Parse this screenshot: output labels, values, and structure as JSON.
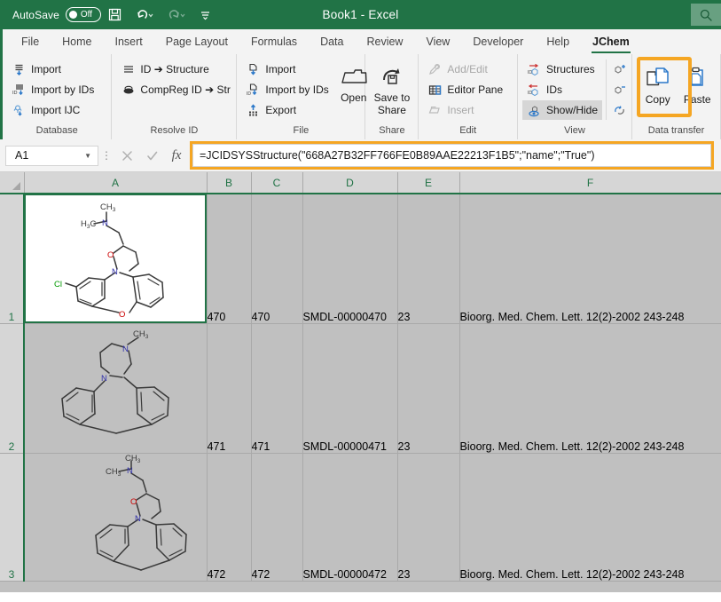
{
  "titlebar": {
    "autosave_label": "AutoSave",
    "autosave_state": "Off",
    "save_icon": "save-icon",
    "undo_icon": "undo-icon",
    "redo_icon": "redo-icon",
    "customize_icon": "customize-quick-access-toolbar-icon",
    "document_title": "Book1  -  Excel",
    "search_icon": "search-icon"
  },
  "tabs": [
    {
      "label": "File",
      "active": false
    },
    {
      "label": "Home",
      "active": false
    },
    {
      "label": "Insert",
      "active": false
    },
    {
      "label": "Page Layout",
      "active": false
    },
    {
      "label": "Formulas",
      "active": false
    },
    {
      "label": "Data",
      "active": false
    },
    {
      "label": "Review",
      "active": false
    },
    {
      "label": "View",
      "active": false
    },
    {
      "label": "Developer",
      "active": false
    },
    {
      "label": "Help",
      "active": false
    },
    {
      "label": "JChem",
      "active": true
    }
  ],
  "ribbon": {
    "groups": [
      {
        "title": "Database",
        "items": [
          {
            "label": "Import",
            "icon": "import-icon",
            "disabled": false
          },
          {
            "label": "Import by IDs",
            "icon": "import-by-ids-icon",
            "disabled": false
          },
          {
            "label": "Import IJC",
            "icon": "import-ijc-icon",
            "disabled": false
          }
        ]
      },
      {
        "title": "Resolve ID",
        "items": [
          {
            "label": "ID ➔ Structure",
            "icon": "id-to-structure-icon",
            "disabled": false
          },
          {
            "label": "CompReg ID ➔ Str",
            "icon": "compreg-id-to-structure-icon",
            "disabled": false
          }
        ]
      },
      {
        "title": "File",
        "items": [
          {
            "label": "Import",
            "icon": "file-import-icon",
            "disabled": false
          },
          {
            "label": "Import by IDs",
            "icon": "file-import-by-ids-icon",
            "disabled": false
          },
          {
            "label": "Export",
            "icon": "file-export-icon",
            "disabled": false
          }
        ],
        "big": [
          {
            "label": "Open",
            "icon": "open-folder-icon",
            "disabled": false
          }
        ]
      },
      {
        "title": "Share",
        "big": [
          {
            "label": "Save to Share",
            "icon": "save-to-share-icon",
            "disabled": false
          }
        ]
      },
      {
        "title": "Edit",
        "items": [
          {
            "label": "Add/Edit",
            "icon": "add-edit-icon",
            "disabled": true
          },
          {
            "label": "Editor Pane",
            "icon": "editor-pane-icon",
            "disabled": false
          },
          {
            "label": "Insert",
            "icon": "insert-icon",
            "disabled": true
          }
        ]
      },
      {
        "title": "View",
        "items": [
          {
            "label": "Structures",
            "icon": "show-structures-icon",
            "disabled": false,
            "toggled": false
          },
          {
            "label": "IDs",
            "icon": "show-ids-icon",
            "disabled": false,
            "toggled": false
          },
          {
            "label": "Show/Hide",
            "icon": "show-hide-eye-icon",
            "disabled": false,
            "toggled": true
          }
        ],
        "side_icons": [
          {
            "icon": "zoom-in-structure-icon"
          },
          {
            "icon": "zoom-out-structure-icon"
          },
          {
            "icon": "refresh-structure-icon"
          }
        ]
      },
      {
        "title": "Data transfer",
        "big": [
          {
            "label": "Copy",
            "icon": "copy-icon",
            "disabled": false,
            "highlighted": true
          },
          {
            "label": "Paste",
            "icon": "paste-icon",
            "disabled": false,
            "highlighted": false
          }
        ]
      }
    ]
  },
  "formula_bar": {
    "name_box_value": "A1",
    "name_box_caret": "chevron-down-icon",
    "cancel_icon": "cancel-icon",
    "enter_icon": "confirm-icon",
    "function_icon": "insert-function-icon",
    "formula": "=JCIDSYSStructure(\"668A27B32FF766FE0B89AAE22213F1B5\";\"name\";\"True\")"
  },
  "sheet": {
    "columns": [
      "A",
      "B",
      "C",
      "D",
      "E",
      "F"
    ],
    "rows": [
      {
        "number": "1",
        "structure": "structure-image-a1",
        "cells": [
          "470",
          "470",
          "SMDL-00000470",
          "23",
          "Bioorg. Med. Chem. Lett. 12(2)-2002 243-248"
        ]
      },
      {
        "number": "2",
        "structure": "structure-image-a2",
        "cells": [
          "471",
          "471",
          "SMDL-00000471",
          "23",
          "Bioorg. Med. Chem. Lett. 12(2)-2002 243-248"
        ]
      },
      {
        "number": "3",
        "structure": "structure-image-a3",
        "cells": [
          "472",
          "472",
          "SMDL-00000472",
          "23",
          "Bioorg. Med. Chem. Lett. 12(2)-2002 243-248"
        ]
      }
    ]
  },
  "colors": {
    "excel_green": "#217346",
    "highlight_orange": "#f5a623",
    "grid_shade": "#c0c0c0",
    "atom_nitrogen": "#3333aa",
    "atom_oxygen": "#cc0000",
    "atom_chlorine": "#009900"
  }
}
